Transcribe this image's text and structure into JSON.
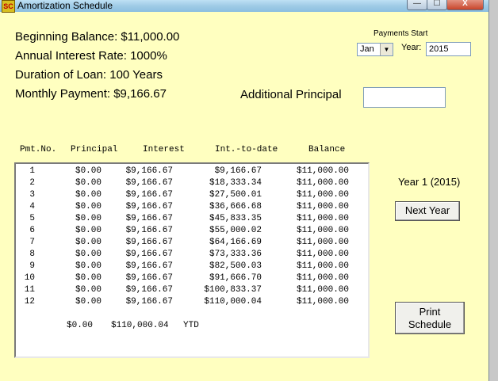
{
  "window": {
    "title": "Amortization Schedule",
    "icon_text": "SC",
    "min_glyph": "—",
    "max_glyph": "☐",
    "close_glyph": "X"
  },
  "summary": {
    "beginning_balance": "Beginning Balance:  $11,000.00",
    "interest_rate": "Annual Interest Rate:  1000%",
    "duration": "Duration of Loan:  100 Years",
    "monthly_payment": "Monthly Payment:  $9,166.67"
  },
  "payments_start": {
    "label": "Payments Start",
    "month_value": "Jan",
    "year_label": "Year:",
    "year_value": "2015"
  },
  "additional_principal": {
    "label": "Additional Principal",
    "value": ""
  },
  "table": {
    "headers": [
      "Pmt.No.",
      "Principal",
      "Interest",
      "Int.-to-date",
      "Balance"
    ],
    "rows": [
      {
        "no": "1",
        "principal": "$0.00",
        "interest": "$9,166.67",
        "itd": "$9,166.67",
        "balance": "$11,000.00"
      },
      {
        "no": "2",
        "principal": "$0.00",
        "interest": "$9,166.67",
        "itd": "$18,333.34",
        "balance": "$11,000.00"
      },
      {
        "no": "3",
        "principal": "$0.00",
        "interest": "$9,166.67",
        "itd": "$27,500.01",
        "balance": "$11,000.00"
      },
      {
        "no": "4",
        "principal": "$0.00",
        "interest": "$9,166.67",
        "itd": "$36,666.68",
        "balance": "$11,000.00"
      },
      {
        "no": "5",
        "principal": "$0.00",
        "interest": "$9,166.67",
        "itd": "$45,833.35",
        "balance": "$11,000.00"
      },
      {
        "no": "6",
        "principal": "$0.00",
        "interest": "$9,166.67",
        "itd": "$55,000.02",
        "balance": "$11,000.00"
      },
      {
        "no": "7",
        "principal": "$0.00",
        "interest": "$9,166.67",
        "itd": "$64,166.69",
        "balance": "$11,000.00"
      },
      {
        "no": "8",
        "principal": "$0.00",
        "interest": "$9,166.67",
        "itd": "$73,333.36",
        "balance": "$11,000.00"
      },
      {
        "no": "9",
        "principal": "$0.00",
        "interest": "$9,166.67",
        "itd": "$82,500.03",
        "balance": "$11,000.00"
      },
      {
        "no": "10",
        "principal": "$0.00",
        "interest": "$9,166.67",
        "itd": "$91,666.70",
        "balance": "$11,000.00"
      },
      {
        "no": "11",
        "principal": "$0.00",
        "interest": "$9,166.67",
        "itd": "$100,833.37",
        "balance": "$11,000.00"
      },
      {
        "no": "12",
        "principal": "$0.00",
        "interest": "$9,166.67",
        "itd": "$110,000.04",
        "balance": "$11,000.00"
      }
    ],
    "ytd": {
      "principal": "$0.00",
      "interest": "$110,000.04",
      "label": "YTD"
    }
  },
  "year_label": "Year 1 (2015)",
  "buttons": {
    "next_year": "Next Year",
    "print_line1": "Print",
    "print_line2": "Schedule"
  }
}
